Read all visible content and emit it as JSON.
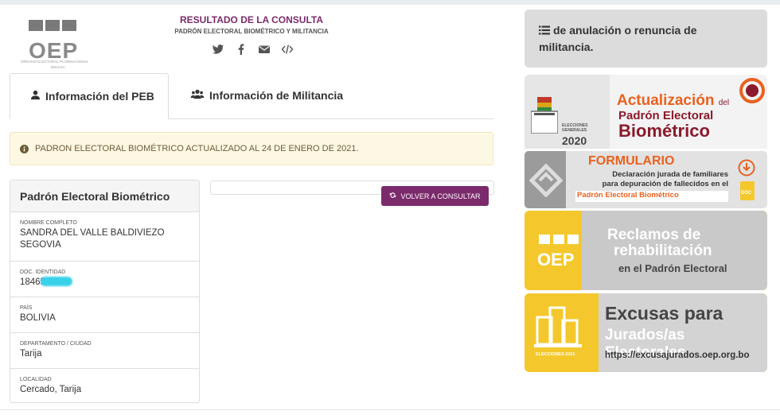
{
  "header": {
    "title": "RESULTADO DE LA CONSULTA",
    "subtitle": "PADRÓN ELECTORAL BIOMÉTRICO Y MILITANCIA"
  },
  "logo": {
    "text": "OEP",
    "line1": "ÓRGANO ELECTORAL PLURINACIONAL",
    "line2": "BOLIVIA"
  },
  "social": [
    "twitter-icon",
    "facebook-icon",
    "envelope-icon",
    "code-icon"
  ],
  "tabs": [
    {
      "label": "Información del PEB",
      "icon": "user-icon",
      "active": true
    },
    {
      "label": "Información de Militancia",
      "icon": "users-icon",
      "active": false
    }
  ],
  "alert": {
    "text": "PADRON ELECTORAL BIOMÉTRICO ACTUALIZADO AL 24 DE ENERO DE 2021."
  },
  "card": {
    "title": "Padrón Electoral Biométrico",
    "fields": [
      {
        "label": "NOMBRE COMPLETO",
        "value_line1": "SANDRA DEL VALLE BALDIVIEZO",
        "value_line2": "SEGOVIA"
      },
      {
        "label": "DOC. IDENTIDAD",
        "value": "18465"
      },
      {
        "label": "PAÍS",
        "value": "BOLIVIA"
      },
      {
        "label": "DEPARTAMENTO / CIUDAD",
        "value": "Tarija"
      },
      {
        "label": "LOCALIDAD",
        "value": "Cercado, Tarija"
      }
    ]
  },
  "volver_button": {
    "label": "VOLVER A CONSULTAR"
  },
  "sidebar": {
    "box_text": "de anulación o renuncia de militancia."
  },
  "banners": {
    "b1": {
      "elecciones": "ELECCIONES",
      "generales": "GENERALES",
      "year": "2020",
      "actualizacion": "Actualización",
      "del": "del",
      "padron": "Padrón Electoral",
      "biometrico": "Biométrico"
    },
    "b2": {
      "formulario": "FORMULARIO",
      "line1": "Declaración jurada de familiares",
      "line2": "para depuración de fallecidos en el",
      "line3": "Padrón Electoral Biométrico",
      "doc": "DOC"
    },
    "b3": {
      "oep": "OEP",
      "line1": "Reclamos de",
      "line2": "rehabilitación",
      "line3": "en el Padrón Electoral"
    },
    "b4": {
      "elecciones": "ELECCIONES 2021",
      "line1": "Excusas para",
      "line2": "Jurados/as Electorales",
      "url": "https://excusajurados.oep.org.bo"
    }
  },
  "colors": {
    "brand": "#7b2a6b",
    "alert_bg": "#fcf8e3",
    "banner_orange": "#e8621f",
    "banner_maroon": "#8b1a2c",
    "banner_yellow": "#f4c82c"
  }
}
